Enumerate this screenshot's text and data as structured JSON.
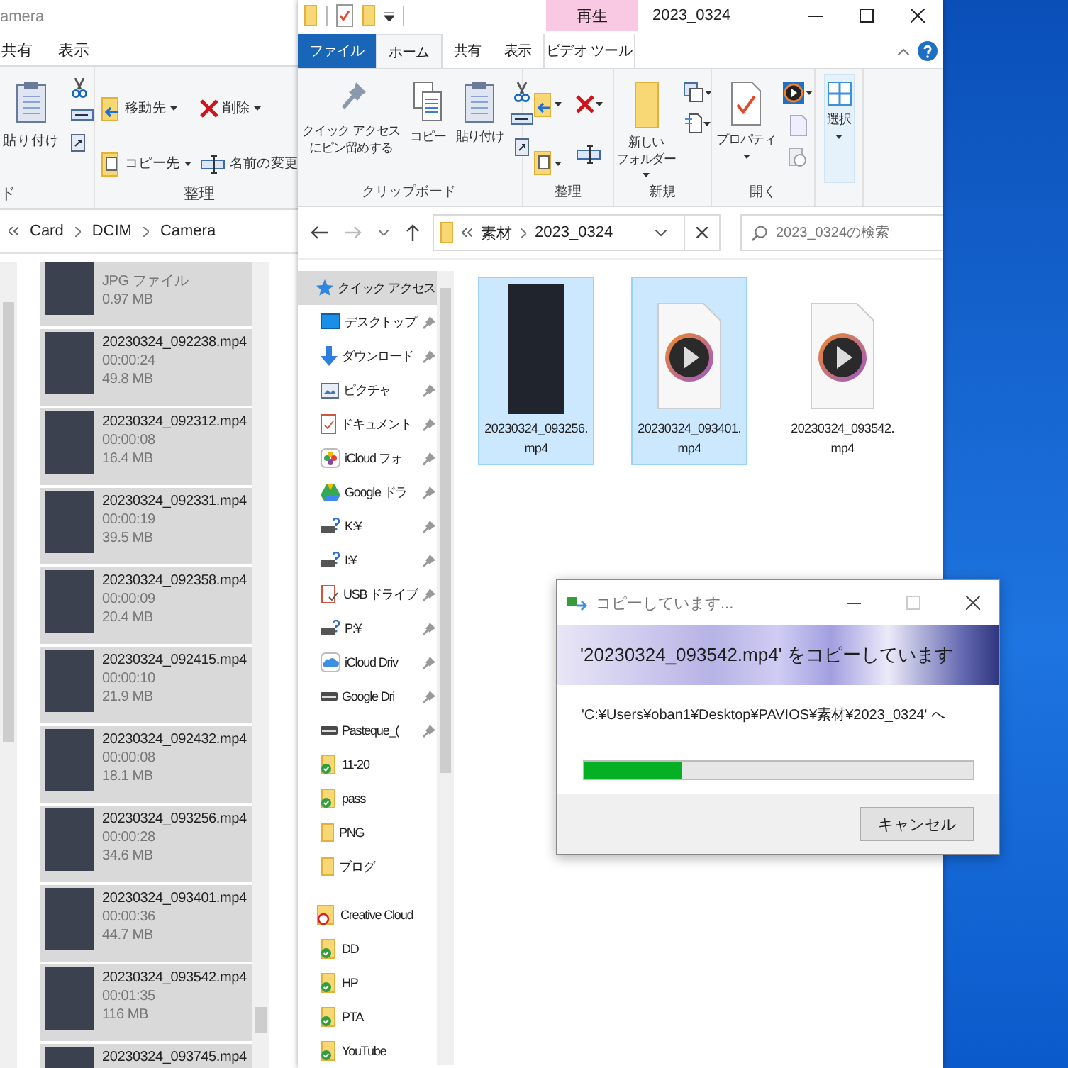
{
  "left_window": {
    "title": "amera",
    "tabs": [
      {
        "label": "共有",
        "selected": false
      },
      {
        "label": "表示",
        "selected": false
      }
    ],
    "ribbon": [
      {
        "label": "ド",
        "buttons": [
          {
            "label": "貼り付け",
            "dropdown": false
          }
        ]
      },
      {
        "label": "整理",
        "buttons": [
          {
            "label": "移動先",
            "dropdown": true
          },
          {
            "label": "コピー先",
            "dropdown": true
          },
          {
            "label": "削除",
            "dropdown": true
          },
          {
            "label": "名前の変更",
            "dropdown": false
          }
        ]
      }
    ],
    "address": [
      "Card",
      "DCIM",
      "Camera"
    ],
    "files": [
      {
        "detail": "JPG ファイル",
        "size": "0.97 MB"
      },
      {
        "name": "20230324_092238.mp4",
        "detail": "00:00:24",
        "size": "49.8 MB"
      },
      {
        "name": "20230324_092312.mp4",
        "detail": "00:00:08",
        "size": "16.4 MB"
      },
      {
        "name": "20230324_092331.mp4",
        "detail": "00:00:19",
        "size": "39.5 MB"
      },
      {
        "name": "20230324_092358.mp4",
        "detail": "00:00:09",
        "size": "20.4 MB"
      },
      {
        "name": "20230324_092415.mp4",
        "detail": "00:00:10",
        "size": "21.9 MB"
      },
      {
        "name": "20230324_092432.mp4",
        "detail": "00:00:08",
        "size": "18.1 MB"
      },
      {
        "name": "20230324_093256.mp4",
        "detail": "00:00:28",
        "size": "34.6 MB"
      },
      {
        "name": "20230324_093401.mp4",
        "detail": "00:00:36",
        "size": "44.7 MB"
      },
      {
        "name": "20230324_093542.mp4",
        "detail": "00:01:35",
        "size": "116 MB"
      },
      {
        "name": "20230324_093745.mp4"
      }
    ]
  },
  "window": {
    "title": "2023_0324",
    "context_header": "再生",
    "tabs": [
      {
        "label": "ファイル",
        "kind": "file",
        "selected": false
      },
      {
        "label": "ホーム",
        "kind": "normal",
        "selected": true
      },
      {
        "label": "共有",
        "kind": "normal",
        "selected": false
      },
      {
        "label": "表示",
        "kind": "normal",
        "selected": false
      },
      {
        "label": "ビデオ ツール",
        "kind": "context",
        "selected": false
      }
    ],
    "ribbon": [
      {
        "label": "クリップボード",
        "buttons": [
          {
            "lines": [
              "クイック アクセス",
              "にピン留めする"
            ],
            "selected": false
          },
          {
            "label": "コピー",
            "selected": false
          },
          {
            "label": "貼り付け",
            "selected": false
          }
        ]
      },
      {
        "label": "整理"
      },
      {
        "label": "新規",
        "buttons": [
          {
            "lines": [
              "新しい",
              "フォルダー"
            ],
            "selected": false
          }
        ]
      },
      {
        "label": "開く",
        "buttons": [
          {
            "label": "プロパティ",
            "selected": false
          }
        ]
      },
      {
        "buttons": [
          {
            "label": "選択",
            "selected": true
          }
        ]
      }
    ],
    "address": [
      "素材",
      "2023_0324"
    ],
    "search": {
      "placeholder": "2023_0324の検索"
    },
    "nav": [
      {
        "label": "クイック アクセス",
        "kind": "star",
        "pinned": false,
        "selected": true,
        "children": [
          {
            "label": "デスクトップ",
            "kind": "desktop",
            "pinned": true,
            "selected": false
          },
          {
            "label": "ダウンロード",
            "kind": "download",
            "pinned": true,
            "selected": false
          },
          {
            "label": "ピクチャ",
            "kind": "pictures",
            "pinned": true,
            "selected": false
          },
          {
            "label": "ドキュメント",
            "kind": "documents",
            "pinned": true,
            "selected": false
          },
          {
            "label": "iCloud フォ",
            "kind": "photos",
            "pinned": true,
            "selected": false
          },
          {
            "label": "Google ドラ",
            "kind": "gdrive",
            "pinned": true,
            "selected": false
          },
          {
            "label": "K:¥",
            "kind": "netdrive",
            "pinned": true,
            "selected": false
          },
          {
            "label": "I:¥",
            "kind": "netdrive",
            "pinned": true,
            "selected": false
          },
          {
            "label": "USB ドライブ",
            "kind": "usb",
            "pinned": true,
            "selected": false
          },
          {
            "label": "P:¥",
            "kind": "netdrive",
            "pinned": true,
            "selected": false
          },
          {
            "label": "iCloud Driv",
            "kind": "cloud",
            "pinned": true,
            "selected": false
          },
          {
            "label": "Google Dri",
            "kind": "drive",
            "pinned": true,
            "selected": false
          },
          {
            "label": "Pasteque_(",
            "kind": "drive",
            "pinned": true,
            "selected": false
          },
          {
            "label": "11-20",
            "kind": "synced",
            "pinned": false,
            "selected": false
          },
          {
            "label": "pass",
            "kind": "synced",
            "pinned": false,
            "selected": false
          },
          {
            "label": "PNG",
            "kind": "folder",
            "pinned": false,
            "selected": false
          },
          {
            "label": "ブログ",
            "kind": "folder",
            "pinned": false,
            "selected": false
          }
        ]
      },
      {
        "label": "Creative Cloud",
        "kind": "cc",
        "pinned": false,
        "selected": false,
        "children": [
          {
            "label": "DD",
            "kind": "synced",
            "pinned": false,
            "selected": false
          },
          {
            "label": "HP",
            "kind": "synced",
            "pinned": false,
            "selected": false
          },
          {
            "label": "PTA",
            "kind": "synced",
            "pinned": false,
            "selected": false
          },
          {
            "label": "YouTube",
            "kind": "synced",
            "pinned": false,
            "selected": false
          }
        ]
      }
    ],
    "files": [
      {
        "name": "20230324_093256.mp4",
        "kind": "thumbnail",
        "selected": true
      },
      {
        "name": "20230324_093401.mp4",
        "kind": "video",
        "selected": true
      },
      {
        "name": "20230324_093542.mp4",
        "kind": "video",
        "selected": false
      }
    ]
  },
  "dialog": {
    "title": "コピーしています...",
    "heading": "'20230324_093542.mp4' をコピーしています",
    "destination": "'C:¥Users¥oban1¥Desktop¥PAVIOS¥素材¥2023_0324' へ",
    "progress": {
      "level": 0.25
    },
    "cancel": "キャンセル"
  }
}
